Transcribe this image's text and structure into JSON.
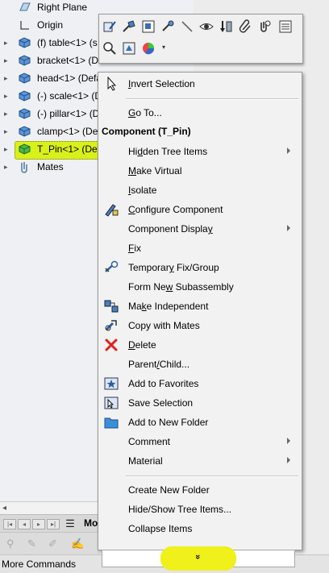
{
  "tree": {
    "items": [
      {
        "label": "Right Plane",
        "icon": "plane-icon"
      },
      {
        "label": "Origin",
        "icon": "origin-icon"
      },
      {
        "label": "(f) table<1> (s",
        "icon": "part-icon"
      },
      {
        "label": "bracket<1> (D",
        "icon": "part-icon"
      },
      {
        "label": "head<1> (Defa",
        "icon": "part-icon"
      },
      {
        "label": "(-) scale<1> (D",
        "icon": "part-icon"
      },
      {
        "label": "(-) pillar<1> (D",
        "icon": "part-icon"
      },
      {
        "label": "clamp<1> (Def",
        "icon": "part-icon"
      },
      {
        "label": "T_Pin<1> (Def",
        "icon": "part-icon-selected"
      },
      {
        "label": "Mates",
        "icon": "mates-icon"
      }
    ],
    "hidden_fragment": "Default"
  },
  "bottom": {
    "tab_label": "Mo",
    "more_commands": "More Commands"
  },
  "toolbar": {
    "row1": [
      "edit-part-icon",
      "smart-mate-icon",
      "edit-assembly-icon",
      "move-component-icon",
      "line-icon",
      "hide-show-icon",
      "exploded-view-icon",
      "paperclip-icon",
      "mates-icon",
      "properties-icon"
    ],
    "row2": [
      "zoom-to-selection-icon",
      "isolate-view-icon",
      "appearance-icon"
    ],
    "dropdown_glyph": "▾"
  },
  "menu": {
    "header": "Component (T_Pin)",
    "footer_glyph": "»",
    "items": {
      "invert_selection": {
        "pre": "",
        "u": "I",
        "post": "nvert Selection"
      },
      "go_to": {
        "pre": "",
        "u": "G",
        "post": "o To..."
      },
      "hidden_tree_items": {
        "pre": "Hi",
        "u": "d",
        "post": "den Tree Items"
      },
      "make_virtual": {
        "pre": "",
        "u": "M",
        "post": "ake Virtual"
      },
      "isolate": {
        "pre": "",
        "u": "I",
        "post": "solate"
      },
      "configure_component": {
        "pre": "",
        "u": "C",
        "post": "onfigure Component"
      },
      "component_display": {
        "pre": "Component Displa",
        "u": "y",
        "post": ""
      },
      "fix": {
        "pre": "",
        "u": "F",
        "post": "ix"
      },
      "temporary_fix": {
        "pre": "Temporar",
        "u": "y",
        "post": " Fix/Group"
      },
      "form_new_subassembly": {
        "pre": "Form Ne",
        "u": "w",
        "post": " Subassembly"
      },
      "make_independent": {
        "pre": "Ma",
        "u": "k",
        "post": "e Independent"
      },
      "copy_with_mates": {
        "pre": "Copy with Mates",
        "u": "",
        "post": ""
      },
      "delete": {
        "pre": "",
        "u": "D",
        "post": "elete"
      },
      "parent_child": {
        "pre": "Parent",
        "u": "/",
        "post": "Child..."
      },
      "add_to_favorites": {
        "pre": "Add to Favorites",
        "u": "",
        "post": ""
      },
      "save_selection": {
        "pre": "Save Selection",
        "u": "",
        "post": ""
      },
      "add_to_new_folder": {
        "pre": "Add to New Folder",
        "u": "",
        "post": ""
      },
      "comment": {
        "pre": "Comment",
        "u": "",
        "post": ""
      },
      "material": {
        "pre": "Material",
        "u": "",
        "post": ""
      },
      "create_new_folder": {
        "pre": "Create New Folder",
        "u": "",
        "post": ""
      },
      "hide_show_tree_items": {
        "pre": "Hide/Show Tree Items...",
        "u": "",
        "post": ""
      },
      "collapse_items": {
        "pre": "Collapse Items",
        "u": "",
        "post": ""
      }
    }
  },
  "colors": {
    "highlight": "#d9f01a",
    "delete_red": "#e0201a",
    "part_blue": "#3a7bc8",
    "selected_green": "#39a83a"
  }
}
